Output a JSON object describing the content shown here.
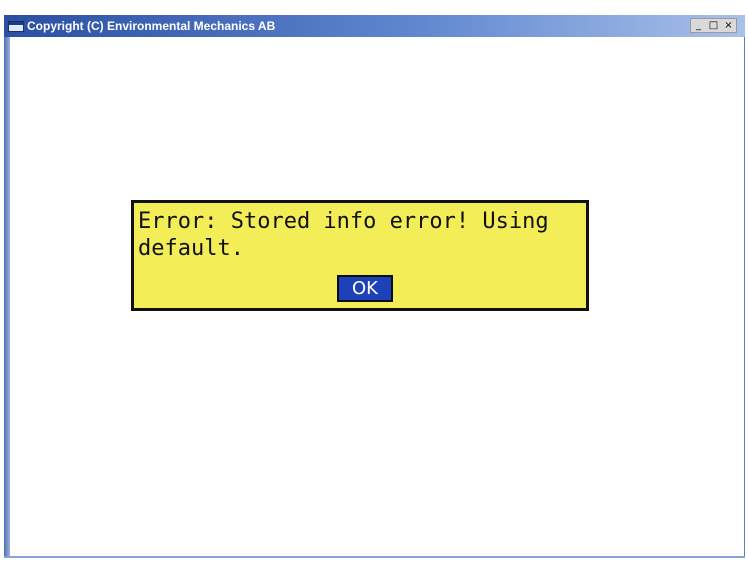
{
  "window": {
    "title": "Copyright (C) Environmental Mechanics AB",
    "controls": {
      "minimize": "_",
      "maximize": "□",
      "close": "×"
    }
  },
  "dialog": {
    "message_line1": "Error: Stored info error! Using",
    "message_line2": "default.",
    "ok_label": "OK"
  },
  "colors": {
    "titlebar_start": "#2a4fa3",
    "titlebar_end": "#a9c1ea",
    "dialog_background": "#f3ee57",
    "ok_button_background": "#1c41b8"
  }
}
